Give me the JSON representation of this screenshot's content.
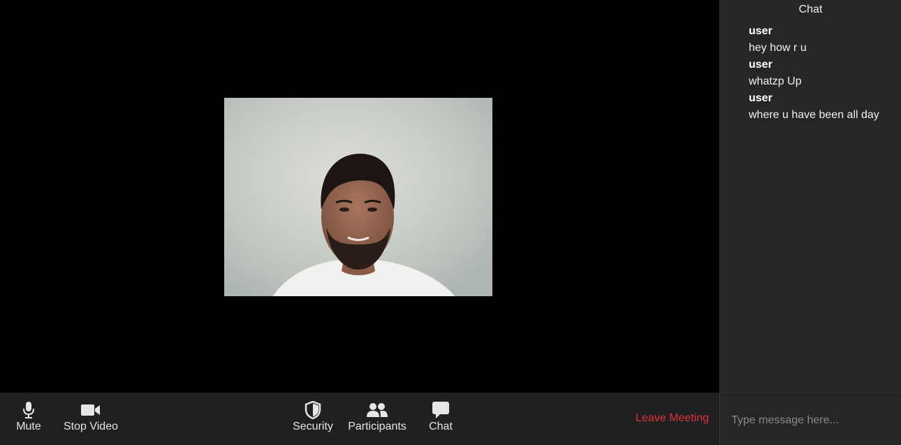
{
  "toolbar": {
    "mute_label": "Mute",
    "stop_video_label": "Stop Video",
    "security_label": "Security",
    "participants_label": "Participants",
    "chat_label": "Chat",
    "leave_label": "Leave Meeting"
  },
  "chat": {
    "title": "Chat",
    "messages": [
      {
        "user": "user",
        "text": "hey how r u"
      },
      {
        "user": "user",
        "text": "whatzp Up"
      },
      {
        "user": "user",
        "text": "where u have been all day"
      }
    ],
    "input_placeholder": "Type message here..."
  },
  "colors": {
    "toolbar_bg": "#1f2022",
    "chat_bg": "#262626",
    "leave_red": "#e02f3a",
    "icon_color": "#e6e6e6"
  }
}
